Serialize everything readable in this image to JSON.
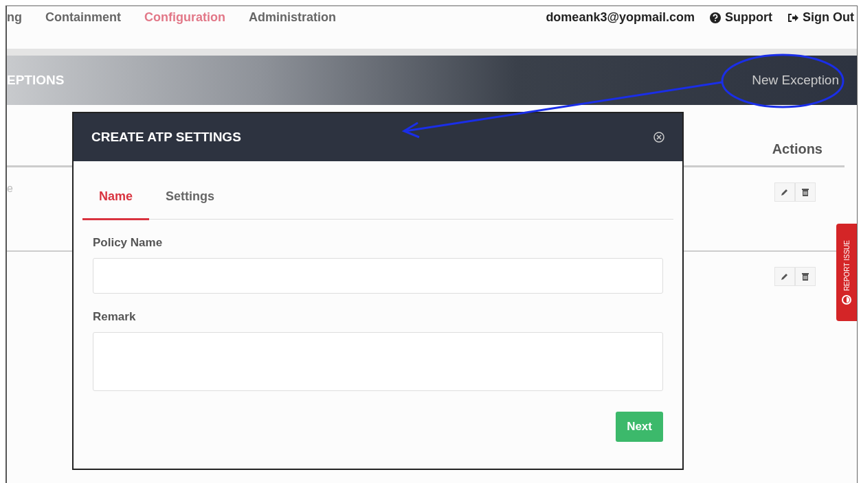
{
  "nav": {
    "items": [
      {
        "label": "ng",
        "selected": false
      },
      {
        "label": "Containment",
        "selected": false
      },
      {
        "label": "Configuration",
        "selected": true
      },
      {
        "label": "Administration",
        "selected": false
      }
    ],
    "user": "domeank3@yopmail.com",
    "support": "Support",
    "sign_out": "Sign Out"
  },
  "banner": {
    "title": "EPTIONS",
    "action": "New Exception"
  },
  "table": {
    "actions_header": "Actions",
    "rows": [
      {
        "column_1": "e"
      },
      {
        "column_1": ""
      }
    ]
  },
  "report_issue": "REPORT ISSUE",
  "modal": {
    "title": "CREATE ATP SETTINGS",
    "tabs": [
      {
        "label": "Name",
        "selected": true
      },
      {
        "label": "Settings",
        "selected": false
      }
    ],
    "fields": [
      {
        "label": "Policy Name",
        "kind": "input"
      },
      {
        "label": "Remark",
        "kind": "textarea"
      }
    ],
    "next": "Next"
  }
}
